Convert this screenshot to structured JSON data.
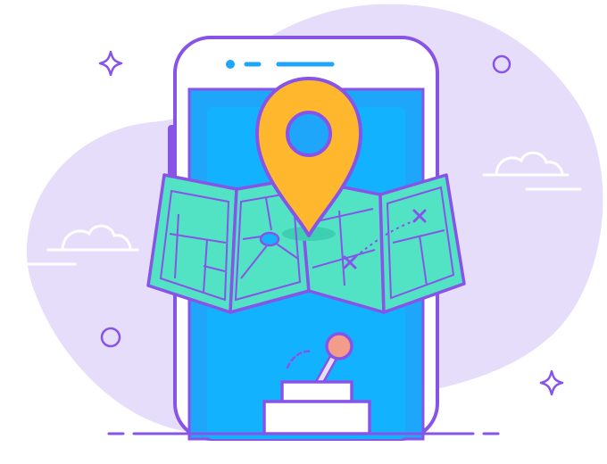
{
  "illustration": {
    "subject": "smartphone-with-folded-map-and-location-pin",
    "icons": [
      "location-pin-icon",
      "folded-map-icon",
      "smartphone-icon",
      "joystick-icon",
      "cloud-icon",
      "sparkle-icon",
      "circle-icon",
      "cross-mark-icon"
    ],
    "colors": {
      "background_blob": "#E6DDFB",
      "outline": "#8854E8",
      "phone_body": "#FFFFFF",
      "phone_screen": "#1EA7FA",
      "phone_screen_inner": "#12B2FF",
      "map_fill": "#52E2C4",
      "map_shade": "#3ECFB2",
      "pin_fill": "#FFB82E",
      "pin_hole": "#1EA7FA",
      "joystick_knob": "#F39C8A",
      "decor_stroke": "#8854E8"
    }
  }
}
